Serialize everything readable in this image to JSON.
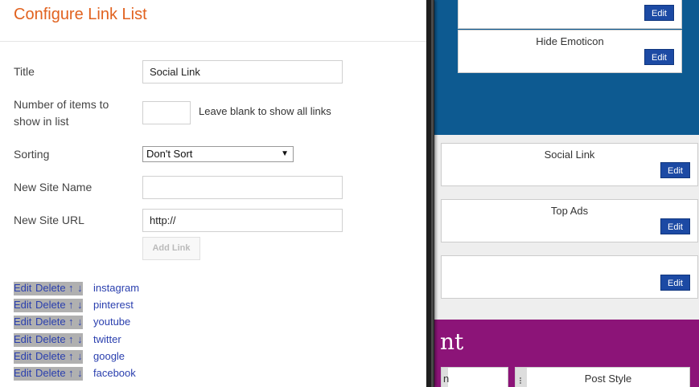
{
  "dialog": {
    "title": "Configure Link List",
    "fields": {
      "title_label": "Title",
      "title_value": "Social Link",
      "count_label": "Number of items to show in list",
      "count_value": "",
      "count_hint": "Leave blank to show all links",
      "sorting_label": "Sorting",
      "sorting_value": "Don't Sort",
      "new_site_name_label": "New Site Name",
      "new_site_name_value": "",
      "new_site_url_label": "New Site URL",
      "new_site_url_value": "http://",
      "add_link_label": "Add Link"
    },
    "link_controls": {
      "edit": "Edit",
      "delete": "Delete",
      "up": "↑",
      "down": "↓"
    },
    "links": [
      {
        "name": "instagram"
      },
      {
        "name": "pinterest"
      },
      {
        "name": "youtube"
      },
      {
        "name": "twitter"
      },
      {
        "name": "google"
      },
      {
        "name": "facebook"
      }
    ]
  },
  "layout_editor": {
    "edit_label": "Edit",
    "gadgets": [
      {
        "name": ""
      },
      {
        "name": "Hide Emoticon"
      },
      {
        "name": "Social Link"
      },
      {
        "name": "Top Ads"
      },
      {
        "name": ""
      }
    ],
    "section_heading_fragment": "nt",
    "sub_gadget_left": "n",
    "sub_gadget_right": "Post Style"
  },
  "colors": {
    "dialog_title": "#e1621f",
    "edit_button": "#1c4aa4",
    "header_band": "#0d5a91",
    "section_band": "#8c1478",
    "link_text": "#2a3fae"
  }
}
